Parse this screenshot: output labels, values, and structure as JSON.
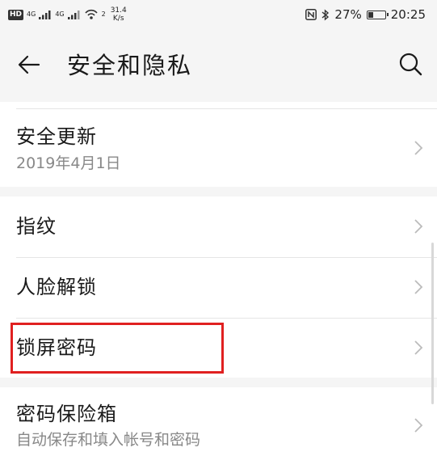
{
  "status_bar": {
    "hd": "HD",
    "network1": "4G",
    "network2": "4G",
    "hotspot_count": "2",
    "speed_value": "31.4",
    "speed_unit": "K/s",
    "battery": "27%",
    "battery_level": 0.27,
    "time": "20:25"
  },
  "app_bar": {
    "title": "安全和隐私"
  },
  "settings": {
    "security_update": {
      "title": "安全更新",
      "subtitle": "2019年4月1日"
    },
    "fingerprint": {
      "title": "指纹"
    },
    "face_unlock": {
      "title": "人脸解锁"
    },
    "lock_screen_password": {
      "title": "锁屏密码"
    },
    "password_vault": {
      "title": "密码保险箱",
      "subtitle": "自动保存和填入帐号和密码"
    }
  },
  "colors": {
    "highlight": "#e02020",
    "background": "#f5f5f5",
    "card": "#ffffff"
  }
}
